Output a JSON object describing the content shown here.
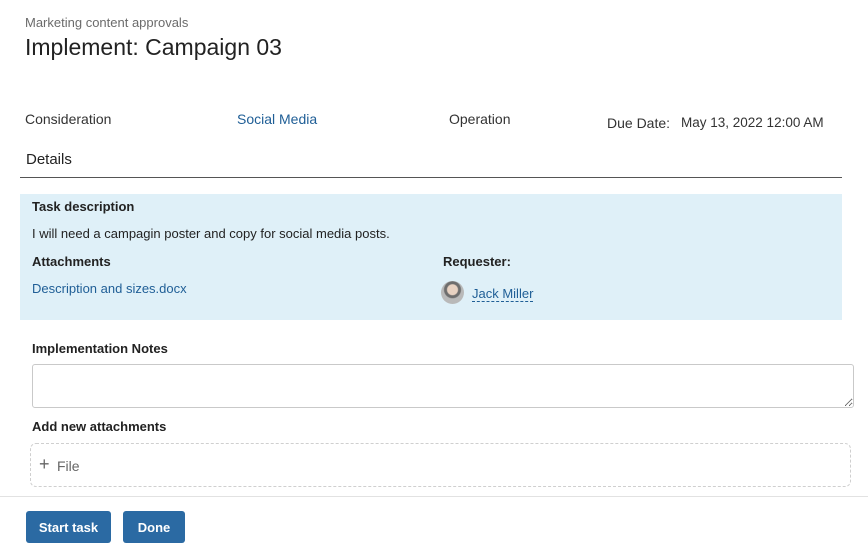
{
  "breadcrumb": "Marketing content approvals",
  "title": "Implement: Campaign 03",
  "meta": {
    "consideration": "Consideration",
    "channel": "Social Media",
    "operation": "Operation",
    "due_label": "Due Date:",
    "due_value": "May 13, 2022 12:00 AM"
  },
  "details": {
    "title": "Details",
    "task_description_label": "Task description",
    "task_description": "I will need a campagin poster and copy for social media posts.",
    "attachments_label": "Attachments",
    "attachment_file": "Description and sizes.docx",
    "requester_label": "Requester:",
    "requester_name": "Jack Miller"
  },
  "form": {
    "implementation_notes_label": "Implementation Notes",
    "implementation_notes_value": "",
    "add_attachments_label": "Add new attachments",
    "file_button": "File"
  },
  "buttons": {
    "start_task": "Start task",
    "done": "Done"
  },
  "colors": {
    "accent": "#2b6aa3",
    "link": "#1f5e96",
    "panel": "#dff0f8"
  }
}
